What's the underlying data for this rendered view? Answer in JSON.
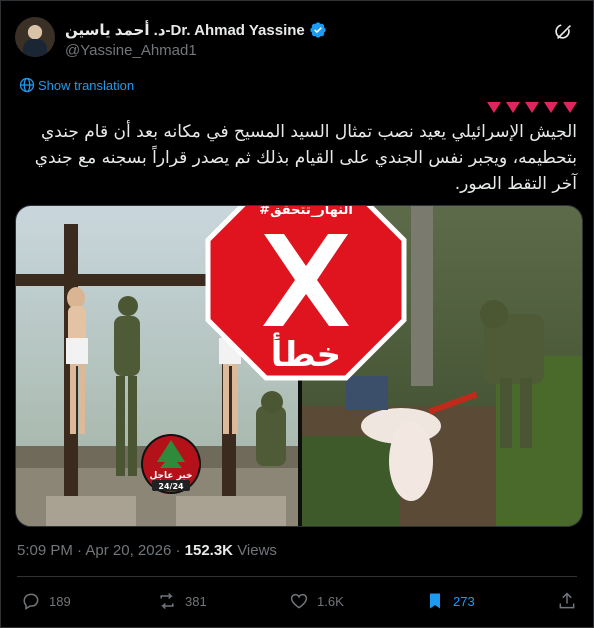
{
  "author": {
    "display_name": "د. أحمد ياسين-Dr. Ahmad Yassine",
    "handle": "@Yassine_Ahmad1"
  },
  "show_translation": "Show translation",
  "tweet": {
    "text": "الجيش الإسرائيلي يعيد نصب تمثال السيد المسيح في مكانه بعد أن قام جندي بتحطيمه، ويجبر نفس الجندي على القيام بذلك ثم يصدر قراراً بسجنه مع جندي آخر التقط الصور."
  },
  "media": {
    "stamp_tag": "#النهار_تتحقق",
    "stamp_verdict": "خطأ",
    "breaking_label": "خبر عاجل",
    "breaking_sub": "24/24"
  },
  "meta": {
    "time": "5:09 PM",
    "date": "Apr 20, 2026",
    "separator": "·",
    "views_count": "152.3K",
    "views_label": "Views"
  },
  "actions": {
    "replies": "189",
    "reposts": "381",
    "likes": "1.6K",
    "bookmarks": "273"
  },
  "colors": {
    "accent": "#1d9bf0",
    "stamp_red": "#e0141e",
    "hearts": "#e0245e"
  }
}
